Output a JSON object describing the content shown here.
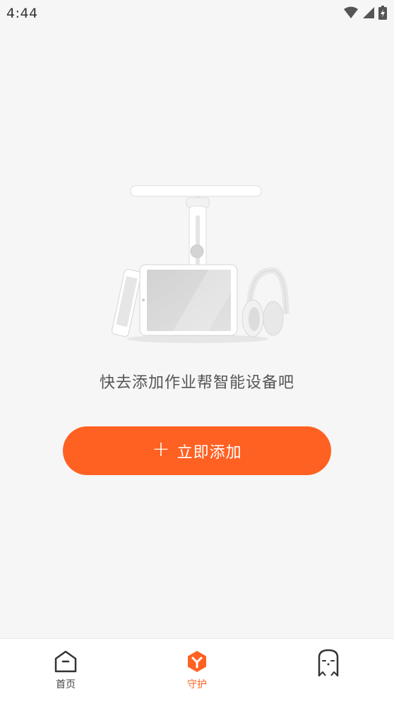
{
  "status_bar": {
    "time": "4:44"
  },
  "empty_state": {
    "message": "快去添加作业帮智能设备吧",
    "illustration": "smart-devices-illustration"
  },
  "add_button": {
    "icon": "plus-icon",
    "label": "立即添加"
  },
  "bottom_nav": {
    "items": [
      {
        "label": "首页",
        "icon": "home-icon",
        "active": false
      },
      {
        "label": "守护",
        "icon": "guard-icon",
        "active": true
      },
      {
        "label": "",
        "icon": "profile-icon",
        "active": false
      }
    ]
  },
  "colors": {
    "accent": "#ff6122",
    "background": "#f6f6f6",
    "text_secondary": "#555555"
  }
}
